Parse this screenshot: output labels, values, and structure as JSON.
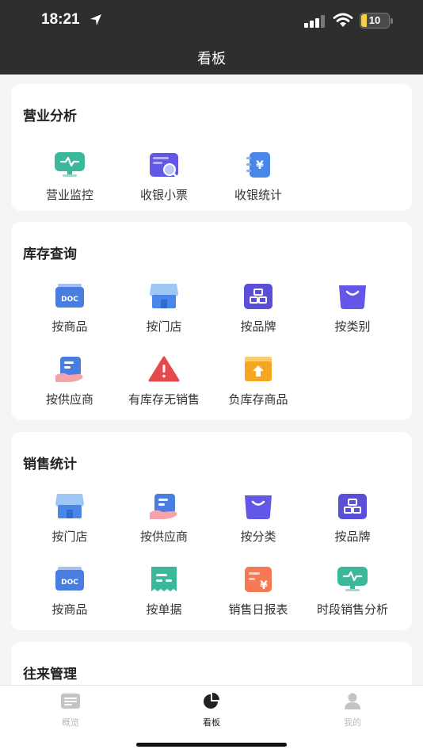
{
  "status_bar": {
    "time": "18:21",
    "battery": "10"
  },
  "nav": {
    "title": "看板"
  },
  "sections": [
    {
      "title": "营业分析",
      "items": [
        {
          "label": "营业监控",
          "icon": "monitor-icon"
        },
        {
          "label": "收银小票",
          "icon": "receipt-icon"
        },
        {
          "label": "收银统计",
          "icon": "cashier-stats-icon"
        }
      ]
    },
    {
      "title": "库存查询",
      "items": [
        {
          "label": "按商品",
          "icon": "doc-icon"
        },
        {
          "label": "按门店",
          "icon": "store-icon"
        },
        {
          "label": "按品牌",
          "icon": "brand-icon"
        },
        {
          "label": "按类别",
          "icon": "bag-icon"
        },
        {
          "label": "按供应商",
          "icon": "supplier-icon"
        },
        {
          "label": "有库存无销售",
          "icon": "warning-icon"
        },
        {
          "label": "负库存商品",
          "icon": "box-upload-icon"
        }
      ]
    },
    {
      "title": "销售统计",
      "items": [
        {
          "label": "按门店",
          "icon": "store-icon"
        },
        {
          "label": "按供应商",
          "icon": "supplier-icon"
        },
        {
          "label": "按分类",
          "icon": "bag-icon"
        },
        {
          "label": "按品牌",
          "icon": "brand-icon"
        },
        {
          "label": "按商品",
          "icon": "doc-icon"
        },
        {
          "label": "按单据",
          "icon": "bill-icon"
        },
        {
          "label": "销售日报表",
          "icon": "daily-report-icon"
        },
        {
          "label": "时段销售分析",
          "icon": "monitor-icon"
        }
      ]
    },
    {
      "title": "往来管理",
      "items": []
    }
  ],
  "tabbar": [
    {
      "label": "概览",
      "icon": "overview-icon",
      "active": false
    },
    {
      "label": "看板",
      "icon": "pie-chart-icon",
      "active": true
    },
    {
      "label": "我的",
      "icon": "user-icon",
      "active": false
    }
  ],
  "colors": {
    "header_bg": "#2e2e2e",
    "page_bg": "#f4f5f7",
    "teal": "#3bb89a",
    "blue": "#4a7de0",
    "purple": "#6357e8",
    "red": "#e5484d",
    "orange": "#f5a623",
    "tab_active": "#222222",
    "tab_inactive": "#bbbbbb"
  }
}
